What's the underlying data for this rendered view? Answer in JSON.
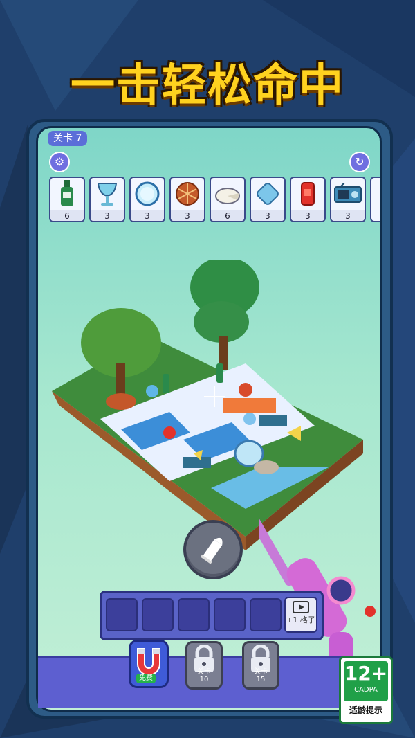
{
  "headline": "一击轻松命中",
  "hud": {
    "level_label": "关卡 7",
    "settings_icon": "gear-icon",
    "restart_icon": "refresh-icon"
  },
  "targets": [
    {
      "icon": "bottle-icon",
      "count": "6"
    },
    {
      "icon": "goblet-icon",
      "count": "3"
    },
    {
      "icon": "plate-icon",
      "count": "3"
    },
    {
      "icon": "pie-icon",
      "count": "3"
    },
    {
      "icon": "cheese-wheel-icon",
      "count": "6"
    },
    {
      "icon": "cushion-icon",
      "count": "3"
    },
    {
      "icon": "soda-can-icon",
      "count": "3"
    },
    {
      "icon": "radio-icon",
      "count": "3"
    }
  ],
  "slots": {
    "extra_slot_label": "+1 格子"
  },
  "powerups": {
    "magnet_badge": "免费",
    "lock1_label_1": "关卡",
    "lock1_label_2": "10",
    "lock2_label_1": "关卡",
    "lock2_label_2": "15"
  },
  "age_rating": {
    "rating": "12+",
    "org": "CADPA",
    "note": "适龄提示"
  },
  "colors": {
    "headline": "#ffd21f",
    "panel": "#5d5fd0",
    "badge_green": "#25b24a"
  }
}
